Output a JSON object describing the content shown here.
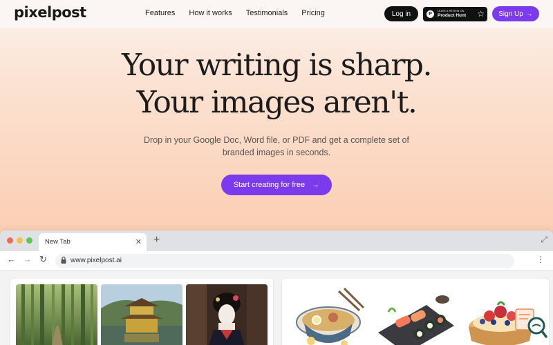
{
  "brand": {
    "logo": "pixelpost",
    "accent": "#7c3aed"
  },
  "nav": {
    "links": [
      "Features",
      "How it works",
      "Testimonials",
      "Pricing"
    ],
    "login": "Log in",
    "producthunt_small": "LEAVE A REVIEW ON",
    "producthunt_big": "Product Hunt",
    "signup": "Sign Up"
  },
  "hero": {
    "title_line1": "Your writing is sharp.",
    "title_line2": "Your images aren't.",
    "subtitle": "Drop in your Google Doc, Word file, or PDF and get a complete set of branded images in seconds.",
    "cta": "Start creating for free"
  },
  "browser": {
    "tab_title": "New Tab",
    "url": "www.pixelpost.ai"
  },
  "icons": [
    "arrow-right-icon",
    "star-icon",
    "close-icon",
    "plus-icon",
    "expand-icon",
    "back-icon",
    "forward-icon",
    "reload-icon",
    "lock-icon",
    "kebab-icon",
    "chat-icon"
  ]
}
